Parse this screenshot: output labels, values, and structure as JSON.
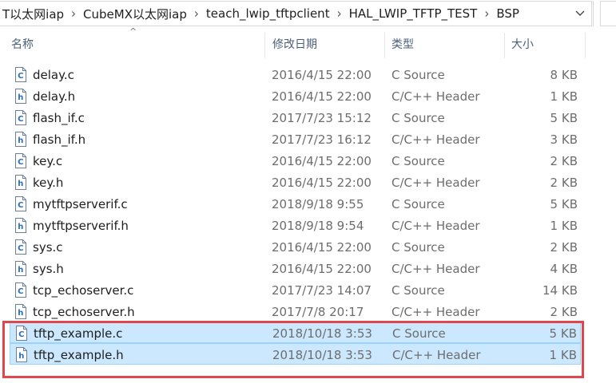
{
  "address_bar": {
    "crumbs": [
      "T以太网iap",
      "CubeMX以太网iap",
      "teach_lwip_tftpclient",
      "HAL_LWIP_TFTP_TEST",
      "BSP"
    ],
    "separator": "›",
    "dropdown_icon": "chevron-down-icon",
    "refresh_icon": "refresh-icon"
  },
  "columns": {
    "name": "名称",
    "date": "修改日期",
    "type": "类型",
    "size": "大小"
  },
  "files": [
    {
      "name": "delay.c",
      "date": "2016/4/15 22:00",
      "type": "C Source",
      "size": "8 KB",
      "kind": "c",
      "selected": false
    },
    {
      "name": "delay.h",
      "date": "2016/4/15 22:00",
      "type": "C/C++ Header",
      "size": "1 KB",
      "kind": "h",
      "selected": false
    },
    {
      "name": "flash_if.c",
      "date": "2017/7/23 15:12",
      "type": "C Source",
      "size": "5 KB",
      "kind": "c",
      "selected": false
    },
    {
      "name": "flash_if.h",
      "date": "2017/7/23 16:12",
      "type": "C/C++ Header",
      "size": "3 KB",
      "kind": "h",
      "selected": false
    },
    {
      "name": "key.c",
      "date": "2016/4/15 22:00",
      "type": "C Source",
      "size": "2 KB",
      "kind": "c",
      "selected": false
    },
    {
      "name": "key.h",
      "date": "2016/4/15 22:00",
      "type": "C/C++ Header",
      "size": "2 KB",
      "kind": "h",
      "selected": false
    },
    {
      "name": "mytftpserverif.c",
      "date": "2018/9/18 9:55",
      "type": "C Source",
      "size": "5 KB",
      "kind": "c",
      "selected": false
    },
    {
      "name": "mytftpserverif.h",
      "date": "2018/9/18 9:54",
      "type": "C/C++ Header",
      "size": "1 KB",
      "kind": "h",
      "selected": false
    },
    {
      "name": "sys.c",
      "date": "2016/4/15 22:00",
      "type": "C Source",
      "size": "2 KB",
      "kind": "c",
      "selected": false
    },
    {
      "name": "sys.h",
      "date": "2016/4/15 22:00",
      "type": "C/C++ Header",
      "size": "4 KB",
      "kind": "h",
      "selected": false
    },
    {
      "name": "tcp_echoserver.c",
      "date": "2017/7/23 14:07",
      "type": "C Source",
      "size": "14 KB",
      "kind": "c",
      "selected": false
    },
    {
      "name": "tcp_echoserver.h",
      "date": "2017/7/8 20:17",
      "type": "C/C++ Header",
      "size": "2 KB",
      "kind": "h",
      "selected": false
    },
    {
      "name": "tftp_example.c",
      "date": "2018/10/18 3:53",
      "type": "C Source",
      "size": "5 KB",
      "kind": "c",
      "selected": true
    },
    {
      "name": "tftp_example.h",
      "date": "2018/10/18 3:53",
      "type": "C/C++ Header",
      "size": "1 KB",
      "kind": "h",
      "selected": true
    }
  ],
  "colors": {
    "selection_bg": "#cce8ff",
    "selection_border": "#99d1ff",
    "annotation": "#e0474c",
    "header_text": "#4c607a",
    "c_icon": "#2a6ebb",
    "h_icon": "#2a6ebb"
  }
}
